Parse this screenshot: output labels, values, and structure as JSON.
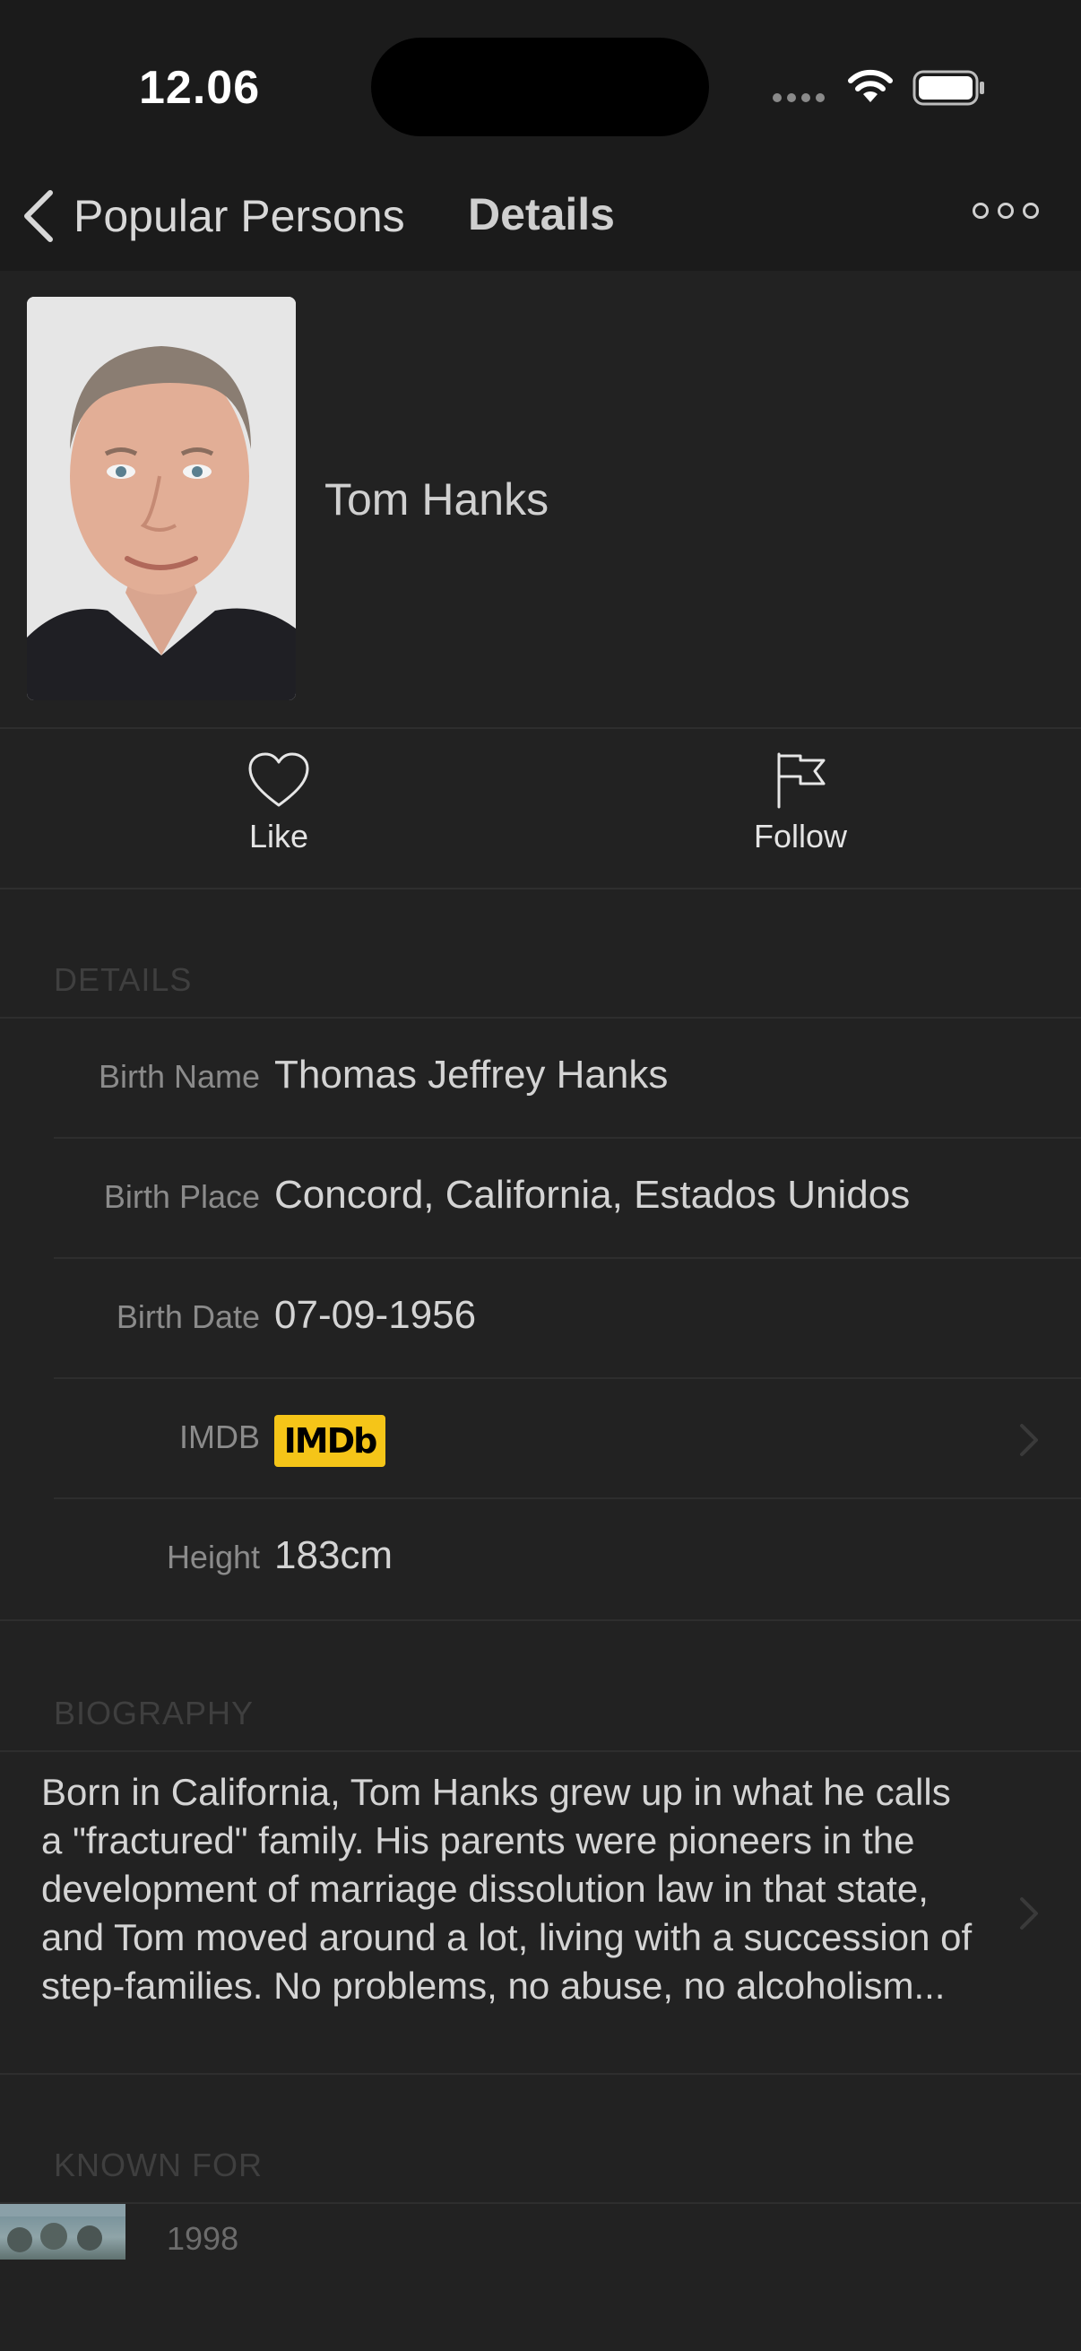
{
  "status": {
    "time": "12.06"
  },
  "nav": {
    "back_label": "Popular Persons",
    "title": "Details"
  },
  "person": {
    "name": "Tom Hanks"
  },
  "actions": {
    "like": "Like",
    "follow": "Follow"
  },
  "details": {
    "header": "DETAILS",
    "rows": [
      {
        "label": "Birth Name",
        "value": "Thomas Jeffrey Hanks"
      },
      {
        "label": "Birth Place",
        "value": "Concord, California, Estados Unidos"
      },
      {
        "label": "Birth Date",
        "value": "07-09-1956"
      },
      {
        "label": "IMDB",
        "badge": "IMDb"
      },
      {
        "label": "Height",
        "value": "183cm"
      }
    ]
  },
  "biography": {
    "header": "BIOGRAPHY",
    "text": "Born in California, Tom Hanks grew up in what he calls a \"fractured\" family. His parents were pioneers in the development of marriage dissolution law in that state, and Tom moved around a lot, living with a succession of step-families. No problems, no abuse, no alcoholism..."
  },
  "known_for": {
    "header": "KNOWN FOR",
    "items": [
      {
        "year": "1998"
      }
    ]
  },
  "colors": {
    "background": "#222222",
    "bar": "#1b1b1b",
    "imdb": "#f5c518"
  }
}
